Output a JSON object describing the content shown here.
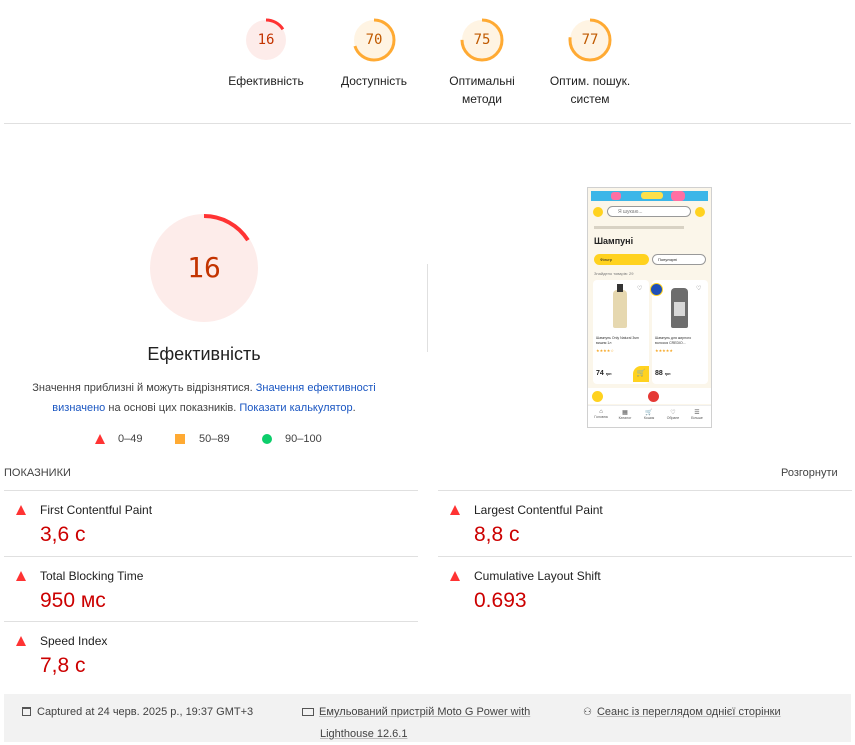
{
  "colors": {
    "fail": "#ff3333",
    "fail_text": "#c00000",
    "average": "#ffaa33",
    "pass": "#0cce6b",
    "link": "#1a56c2"
  },
  "top_scores": [
    {
      "score": "16",
      "label": "Ефективність",
      "level": "fail",
      "value": 16
    },
    {
      "score": "70",
      "label": "Доступність",
      "level": "average",
      "value": 70
    },
    {
      "score": "75",
      "label": "Оптимальні методи",
      "level": "average",
      "value": 75
    },
    {
      "score": "77",
      "label": "Оптим. пошук. систем",
      "level": "average",
      "value": 77
    }
  ],
  "performance": {
    "score": "16",
    "value": 16,
    "title": "Ефективність",
    "desc_part1": "Значення приблизні й можуть відрізнятися. ",
    "desc_link1": "Значення ефективності визначено",
    "desc_part2": " на основі цих показників. ",
    "desc_link2": "Показати калькулятор",
    "desc_end": "."
  },
  "legend": {
    "fail": "0–49",
    "average": "50–89",
    "pass": "90–100"
  },
  "metrics_section": {
    "title": "ПОКАЗНИКИ",
    "expand": "Розгорнути",
    "items": [
      {
        "name": "First Contentful Paint",
        "value": "3,6 с"
      },
      {
        "name": "Largest Contentful Paint",
        "value": "8,8 с"
      },
      {
        "name": "Total Blocking Time",
        "value": "950 мс"
      },
      {
        "name": "Cumulative Layout Shift",
        "value": "0.693"
      },
      {
        "name": "Speed Index",
        "value": "7,8 с"
      }
    ]
  },
  "footer": {
    "captured": "Captured at 24 черв. 2025 р., 19:37 GMT+3",
    "device": "Емульований пристрій Moto G Power with",
    "lighthouse": "Lighthouse 12.6.1",
    "session": "Сеанс із переглядом однієї сторінки"
  },
  "screenshot": {
    "search_placeholder": "Я шукаю...",
    "heading": "Шампуні",
    "filter1": "Фільтр",
    "filter2": "Популярні",
    "found": "Знайдено товарів:",
    "found_count": "29",
    "product1_name": "Шампунь Only Natural 3sm вишня 1л",
    "product1_price": "74",
    "product2_name": "Шампунь для жирного волосся CREDIO...",
    "product2_price": "88",
    "price_unit": "грн",
    "nav": [
      "Головна",
      "Каталог",
      "Кошик",
      "Обране",
      "Більше"
    ]
  }
}
